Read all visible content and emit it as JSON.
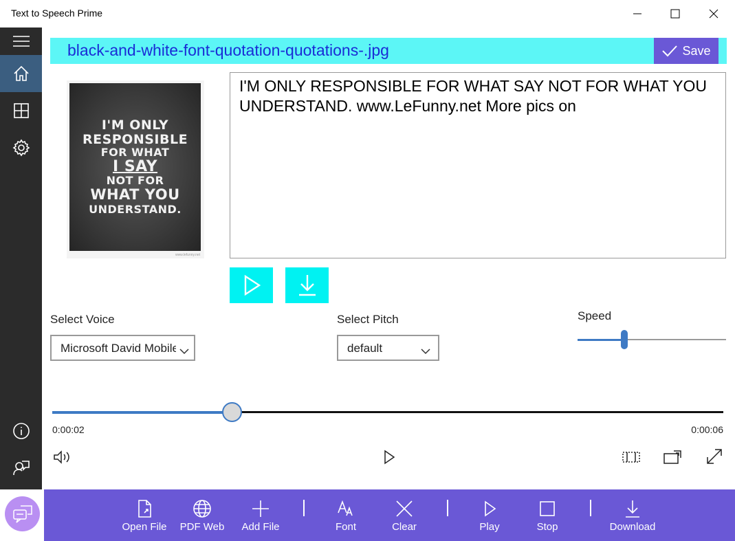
{
  "window": {
    "title": "Text to Speech Prime",
    "minimize_icon": "minimize-icon",
    "maximize_icon": "maximize-icon",
    "close_icon": "close-icon"
  },
  "sidebar": {
    "items": [
      {
        "name": "menu",
        "icon": "hamburger-icon"
      },
      {
        "name": "home",
        "icon": "home-icon",
        "active": true
      },
      {
        "name": "apps",
        "icon": "grid-icon"
      },
      {
        "name": "settings",
        "icon": "gear-icon"
      },
      {
        "name": "about",
        "icon": "info-icon"
      },
      {
        "name": "feedback",
        "icon": "feedback-person-icon"
      }
    ]
  },
  "file": {
    "name": "black-and-white-font-quotation-quotations-.jpg",
    "save_label": "Save"
  },
  "image": {
    "lines": [
      "I'M ONLY",
      "RESPONSIBLE",
      "FOR WHAT",
      "I SAY",
      "NOT FOR",
      "WHAT YOU",
      "UNDERSTAND."
    ],
    "credit": "www.lefunny.net"
  },
  "text_content": "I'M ONLY RESPONSIBLE FOR WHAT SAY NOT FOR WHAT YOU UNDERSTAND. www.LeFunny.net More pics on",
  "voice": {
    "label": "Select Voice",
    "value": "Microsoft David Mobile"
  },
  "pitch": {
    "label": "Select Pitch",
    "value": "default"
  },
  "speed": {
    "label": "Speed",
    "level": 0.32
  },
  "player": {
    "current_time": "0:00:02",
    "total_time": "0:00:06",
    "progress": 0.33
  },
  "toolbar": {
    "open_file": "Open File",
    "pdf_web": "PDF Web",
    "add_file": "Add File",
    "font": "Font",
    "clear": "Clear",
    "play": "Play",
    "stop": "Stop",
    "download": "Download"
  },
  "colors": {
    "accent_purple": "#6a58d6",
    "cyan": "#5cf6f6",
    "sidebar": "#2b2b2b",
    "slider_blue": "#3e7ac4"
  }
}
